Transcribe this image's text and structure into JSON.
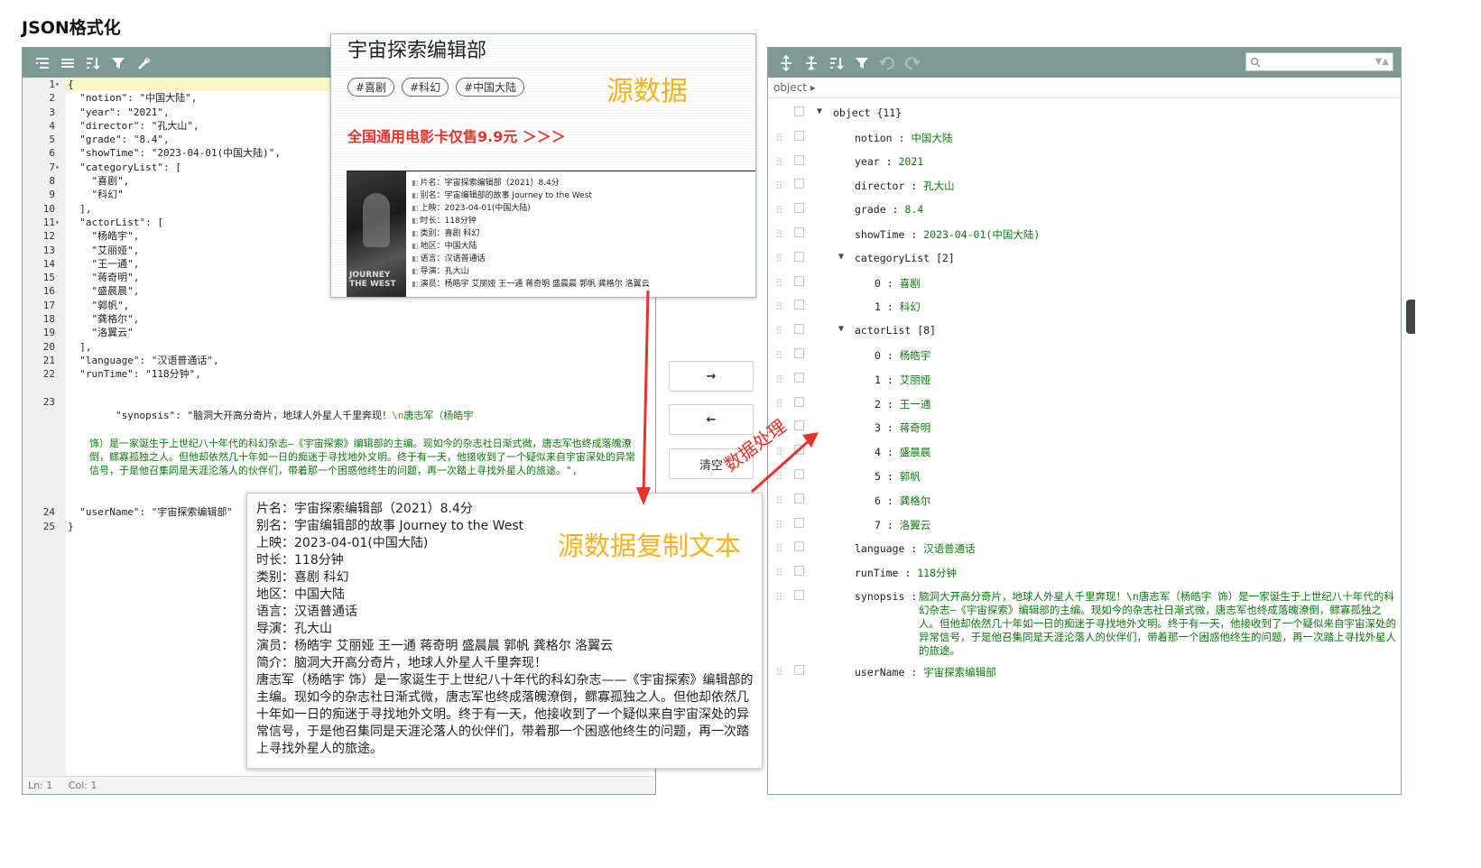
{
  "page": {
    "title": "JSON格式化"
  },
  "code_editor": {
    "status_line": "Ln: 1",
    "status_col": "Col: 1",
    "lines": [
      {
        "n": "1",
        "text": "{"
      },
      {
        "n": "2",
        "text": "  \"notion\": \"中国大陆\","
      },
      {
        "n": "3",
        "text": "  \"year\": \"2021\","
      },
      {
        "n": "4",
        "text": "  \"director\": \"孔大山\","
      },
      {
        "n": "5",
        "text": "  \"grade\": \"8.4\","
      },
      {
        "n": "6",
        "text": "  \"showTime\": \"2023-04-01(中国大陆)\","
      },
      {
        "n": "7",
        "text": "  \"categoryList\": ["
      },
      {
        "n": "8",
        "text": "    \"喜剧\","
      },
      {
        "n": "9",
        "text": "    \"科幻\""
      },
      {
        "n": "10",
        "text": "  ],"
      },
      {
        "n": "11",
        "text": "  \"actorList\": ["
      },
      {
        "n": "12",
        "text": "    \"杨皓宇\","
      },
      {
        "n": "13",
        "text": "    \"艾丽娅\","
      },
      {
        "n": "14",
        "text": "    \"王一通\","
      },
      {
        "n": "15",
        "text": "    \"蒋奇明\","
      },
      {
        "n": "16",
        "text": "    \"盛晨晨\","
      },
      {
        "n": "17",
        "text": "    \"郭帆\","
      },
      {
        "n": "18",
        "text": "    \"龚格尔\","
      },
      {
        "n": "19",
        "text": "    \"洛翼云\""
      },
      {
        "n": "20",
        "text": "  ],"
      },
      {
        "n": "21",
        "text": "  \"language\": \"汉语普通话\","
      },
      {
        "n": "22",
        "text": "  \"runTime\": \"118分钟\","
      }
    ],
    "synopsis_line_no": "23",
    "synopsis_head": "  \"synopsis\": \"脑洞大开高分奇片，地球人外星人千里奔现！",
    "synopsis_escape": "\\n",
    "synopsis_head_tail": "唐志军（杨皓宇",
    "synopsis_wrap": "饰）是一家诞生于上世纪八十年代的科幻杂志—《宇宙探索》编辑部的主编。现如今的杂志社日渐式微，唐志军也终成落魄潦倒，鳏寡孤独之人。但他却依然几十年如一日的痴迷于寻找地外文明。终于有一天，他接收到了一个疑似来自宇宙深处的异常信号，于是他召集同是天涯沦落人的伙伴们，带着那一个困惑他终生的问题，再一次踏上寻找外星人的旅途。\",",
    "tail_lines": [
      {
        "n": "24",
        "text": "  \"userName\": \"宇宙探索编辑部\""
      },
      {
        "n": "25",
        "text": "}"
      }
    ]
  },
  "buttons": {
    "to_right": "→",
    "to_left": "←",
    "clear": "清空"
  },
  "tree": {
    "nav": "object ▸",
    "root": "object {11}",
    "fields": [
      {
        "key": "notion",
        "value": "中国大陆"
      },
      {
        "key": "year",
        "value": "2021"
      },
      {
        "key": "director",
        "value": "孔大山"
      },
      {
        "key": "grade",
        "value": "8.4"
      },
      {
        "key": "showTime",
        "value": "2023-04-01(中国大陆)"
      }
    ],
    "category_head": "categoryList [2]",
    "categories": [
      {
        "idx": "0",
        "value": "喜剧"
      },
      {
        "idx": "1",
        "value": "科幻"
      }
    ],
    "actor_head": "actorList [8]",
    "actors": [
      {
        "idx": "0",
        "value": "杨皓宇"
      },
      {
        "idx": "1",
        "value": "艾丽娅"
      },
      {
        "idx": "2",
        "value": "王一通"
      },
      {
        "idx": "3",
        "value": "蒋奇明"
      },
      {
        "idx": "4",
        "value": "盛晨晨"
      },
      {
        "idx": "5",
        "value": "郭帆"
      },
      {
        "idx": "6",
        "value": "龚格尔"
      },
      {
        "idx": "7",
        "value": "洛翼云"
      }
    ],
    "language": {
      "key": "language",
      "value": "汉语普通话"
    },
    "runTime": {
      "key": "runTime",
      "value": "118分钟"
    },
    "synopsis": {
      "key": "synopsis",
      "value": "脑洞大开高分奇片，地球人外星人千里奔现！\\n唐志军（杨皓宇 饰）是一家诞生于上世纪八十年代的科幻杂志—《宇宙探索》编辑部的主编。现如今的杂志社日渐式微，唐志军也终成落魄潦倒，鳏寡孤独之人。但他却依然几十年如一日的痴迷于寻找地外文明。终于有一天，他接收到了一个疑似来自宇宙深处的异常信号，于是他召集同是天涯沦落人的伙伴们，带着那一个困惑他终生的问题，再一次踏上寻找外星人的旅途。"
    },
    "userName": {
      "key": "userName",
      "value": "宇宙探索编辑部"
    }
  },
  "movie_card": {
    "title": "宇宙探索编辑部",
    "tags": [
      "#喜剧",
      "#科幻",
      "#中国大陆"
    ],
    "promo": "全国通用电影卡仅售9.9元 ＞＞＞",
    "poster_text": "JOURNEY\nTHE WEST",
    "info": [
      "片名：宇宙探索编辑部（2021）8.4分",
      "别名：宇宙编辑部的故事 Journey to the West",
      "上映：2023-04-01(中国大陆)",
      "时长：118分钟",
      "类别：喜剧 科幻",
      "地区：中国大陆",
      "语言：汉语普通话",
      "导演：孔大山",
      "演员：杨皓宇 艾丽娅 王一通 蒋奇明 盛晨晨 郭帆 龚格尔 洛翼云"
    ]
  },
  "copied_text": {
    "lines": [
      "片名：宇宙探索编辑部（2021）8.4分",
      "别名：宇宙编辑部的故事 Journey to the West",
      "上映：2023-04-01(中国大陆)",
      "时长：118分钟",
      "类别：喜剧 科幻",
      "地区：中国大陆",
      "语言：汉语普通话",
      "导演：孔大山",
      "演员：杨皓宇 艾丽娅 王一通 蒋奇明 盛晨晨 郭帆 龚格尔 洛翼云",
      "简介：脑洞大开高分奇片，地球人外星人千里奔现！"
    ],
    "paragraph": "唐志军（杨皓宇 饰）是一家诞生于上世纪八十年代的科幻杂志——《宇宙探索》编辑部的主编。现如今的杂志社日渐式微，唐志军也终成落魄潦倒，鳏寡孤独之人。但他却依然几十年如一日的痴迷于寻找地外文明。终于有一天，他接收到了一个疑似来自宇宙深处的异常信号，于是他召集同是天涯沦落人的伙伴们，带着那一个困惑他终生的问题，再一次踏上寻找外星人的旅途。"
  },
  "annotations": {
    "source": "源数据",
    "copy": "源数据复制文本",
    "process": "数据处理",
    "source_color": "#f7b21e",
    "arrow_color": "#e8322c"
  },
  "icons": {
    "toolbar_left": [
      "format-icon",
      "compact-icon",
      "sort-icon",
      "filter-icon",
      "repair-icon"
    ],
    "toolbar_right": [
      "expand-all-icon",
      "collapse-all-icon",
      "sort-icon",
      "filter-icon",
      "undo-icon",
      "redo-icon",
      "search-icon",
      "dropdown-icon"
    ]
  }
}
